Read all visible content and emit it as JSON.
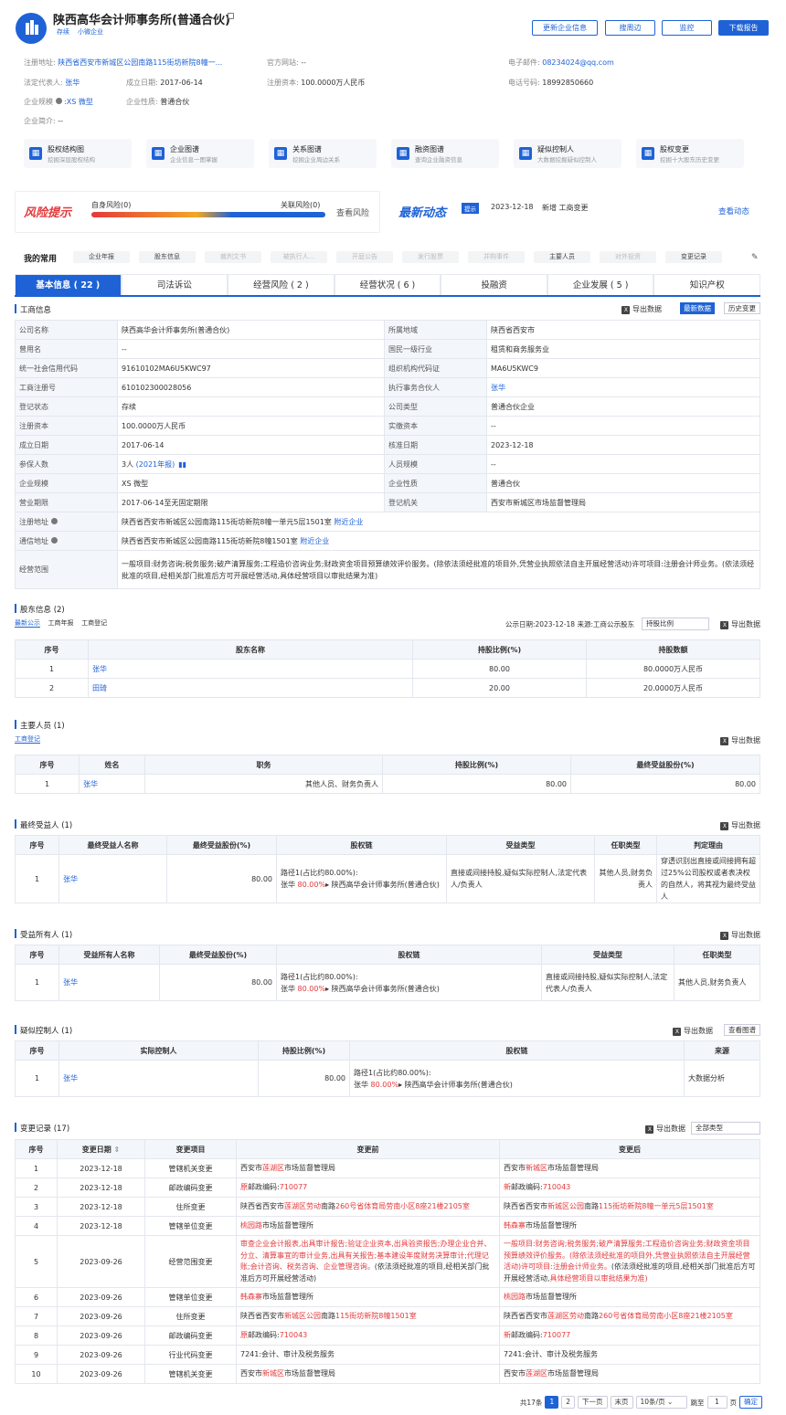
{
  "company": {
    "name": "陕西高华会计师事务所(普通合伙)",
    "status_tag": "存续",
    "size_tag": "小微企业"
  },
  "top_buttons": {
    "update": "更新企业信息",
    "nearby": "搜周边",
    "monitor": "监控",
    "download": "下载报告"
  },
  "basic": {
    "addr_label": "注册地址:",
    "addr_value": "陕西省西安市新城区公园南路115街坊新院8幢一...",
    "website_label": "官方网站:",
    "website_value": "--",
    "email_label": "电子邮件:",
    "email_value": "08234024@qq.com",
    "legal_label": "法定代表人:",
    "legal_value": "张华",
    "found_label": "成立日期:",
    "found_value": "2017-06-14",
    "capital_label": "注册资本:",
    "capital_value": "100.0000万人民币",
    "phone_label": "电话号码:",
    "phone_value": "18992850660",
    "scale_label": "企业规模",
    "scale_value": ":XS 微型",
    "nature_label": "企业性质:",
    "nature_value": "普通合伙",
    "intro_label": "企业简介:",
    "intro_value": "--"
  },
  "tools": [
    {
      "title": "股权结构图",
      "sub": "挖掘深层股权结构",
      "icon": "structure-icon"
    },
    {
      "title": "企业图谱",
      "sub": "企业信息一图掌握",
      "icon": "graph-icon"
    },
    {
      "title": "关系图谱",
      "sub": "挖掘企业周边关系",
      "icon": "relation-icon"
    },
    {
      "title": "融资图谱",
      "sub": "查询企业融资信息",
      "icon": "finance-icon"
    },
    {
      "title": "疑似控制人",
      "sub": "大数据挖掘疑似控制人",
      "icon": "person-icon"
    },
    {
      "title": "股权变更",
      "sub": "挖掘十大股东历史变更",
      "icon": "history-icon"
    }
  ],
  "risk": {
    "title": "风险提示",
    "self": "自身风险(0)",
    "related": "关联风险(0)",
    "view": "查看风险"
  },
  "news": {
    "title": "最新动态",
    "badge": "提示",
    "date": "2023-12-18",
    "text": "新增 工商变更",
    "view": "查看动态"
  },
  "common": {
    "title": "我的常用",
    "chips": [
      "企业年报",
      "股东信息",
      "裁判文书",
      "被执行人...",
      "开庭公告",
      "发行股票",
      "并购事件",
      "主要人员",
      "对外投资",
      "变更记录"
    ],
    "disabled": [
      2,
      3,
      4,
      5,
      6,
      8
    ]
  },
  "tabs": [
    "基本信息 ( 22 )",
    "司法诉讼",
    "经营风险 ( 2 )",
    "经营状况 ( 6 )",
    "投融资",
    "企业发展 ( 5 )",
    "知识产权"
  ],
  "gs": {
    "title": "工商信息",
    "export": "导出数据",
    "latest": "最新数据",
    "history": "历史变更",
    "rows": [
      [
        "公司名称",
        "陕西高华会计师事务所(普通合伙)",
        "所属地域",
        "陕西省西安市"
      ],
      [
        "曾用名",
        "--",
        "国民一级行业",
        "租赁和商务服务业"
      ],
      [
        "统一社会信用代码",
        "91610102MA6U5KWC97",
        "组织机构代码证",
        "MA6U5KWC9"
      ],
      [
        "工商注册号",
        "610102300028056",
        "执行事务合伙人",
        "张华"
      ],
      [
        "登记状态",
        "存续",
        "公司类型",
        "普通合伙企业"
      ],
      [
        "注册资本",
        "100.0000万人民币",
        "实缴资本",
        "--"
      ],
      [
        "成立日期",
        "2017-06-14",
        "核准日期",
        "2023-12-18"
      ],
      [
        "参保人数",
        "3人",
        "人员规模",
        "--"
      ],
      [
        "企业规模",
        "XS 微型",
        "企业性质",
        "普通合伙"
      ],
      [
        "营业期限",
        "2017-06-14至无固定期限",
        "登记机关",
        "西安市新城区市场监督管理局"
      ]
    ],
    "insured_year": "(2021年报)",
    "reg_addr_label": "注册地址",
    "reg_addr": "陕西省西安市新城区公园南路115街坊新院8幢一单元5层1501室",
    "nearby": "附近企业",
    "mail_addr_label": "通信地址",
    "mail_addr": "陕西省西安市新城区公园南路115街坊新院8幢1501室",
    "scope_label": "经营范围",
    "scope": "一般项目:财务咨询;税务服务;破产清算服务;工程造价咨询业务;财政资金项目预算绩效评价服务。(除依法须经批准的项目外,凭营业执照依法自主开展经营活动)许可项目:注册会计师业务。(依法须经批准的项目,经相关部门批准后方可开展经营活动,具体经营项目以审批结果为准)"
  },
  "shareholders": {
    "title": "股东信息 (2)",
    "subtabs": [
      "最新公示",
      "工商年报",
      "工商登记"
    ],
    "pubinfo": "公示日期:2023-12-18 来源:工商公示股东",
    "sort": "持股比例",
    "export": "导出数据",
    "headers": [
      "序号",
      "股东名称",
      "持股比例(%)",
      "持股数额"
    ],
    "rows": [
      [
        "1",
        "张华",
        "80.00",
        "80.0000万人民币"
      ],
      [
        "2",
        "田琦",
        "20.00",
        "20.0000万人民币"
      ]
    ]
  },
  "persons": {
    "title": "主要人员 (1)",
    "subtab": "工商登记",
    "export": "导出数据",
    "headers": [
      "序号",
      "姓名",
      "职务",
      "持股比例(%)",
      "最终受益股份(%)"
    ],
    "rows": [
      [
        "1",
        "张华",
        "其他人员、财务负责人",
        "80.00",
        "80.00"
      ]
    ]
  },
  "ubo": {
    "title": "最终受益人 (1)",
    "export": "导出数据",
    "headers": [
      "序号",
      "最终受益人名称",
      "最终受益股份(%)",
      "股权链",
      "受益类型",
      "任职类型",
      "判定理由"
    ],
    "row": {
      "no": "1",
      "name": "张华",
      "pct": "80.00",
      "path": "路径1(占比约80.00%):",
      "from": "张华",
      "chain_pct": "80.00%",
      "to": "陕西高华会计师事务所(普通合伙)",
      "type": "直接或间接持股,疑似实际控制人,法定代表人/负责人",
      "job": "其他人员,财务负责人",
      "reason": "穿透识别出直接或间接拥有超过25%公司股权或者表决权的自然人，将其视为最终受益人"
    }
  },
  "bo": {
    "title": "受益所有人 (1)",
    "export": "导出数据",
    "headers": [
      "序号",
      "受益所有人名称",
      "最终受益股份(%)",
      "股权链",
      "受益类型",
      "任职类型"
    ],
    "row": {
      "no": "1",
      "name": "张华",
      "pct": "80.00",
      "path": "路径1(占比约80.00%):",
      "from": "张华",
      "chain_pct": "80.00%",
      "to": "陕西高华会计师事务所(普通合伙)",
      "type": "直接或间接持股,疑似实际控制人,法定代表人/负责人",
      "job": "其他人员,财务负责人"
    }
  },
  "ctrl": {
    "title": "疑似控制人 (1)",
    "export": "导出数据",
    "view": "查看图谱",
    "headers": [
      "序号",
      "实际控制人",
      "持股比例(%)",
      "股权链",
      "来源"
    ],
    "row": {
      "no": "1",
      "name": "张华",
      "pct": "80.00",
      "path": "路径1(占比约80.00%):",
      "from": "张华",
      "chain_pct": "80.00%",
      "to": "陕西高华会计师事务所(普通合伙)",
      "src": "大数据分析"
    }
  },
  "changes": {
    "title": "变更记录 (17)",
    "export": "导出数据",
    "filter": "全部类型",
    "headers": [
      "序号",
      "变更日期",
      "变更项目",
      "变更前",
      "变更后"
    ],
    "rows": [
      {
        "no": "1",
        "date": "2023-12-18",
        "item": "管辖机关变更",
        "before": [
          [
            "西安市",
            0
          ],
          [
            "莲湖区",
            1
          ],
          [
            "市场监督管理局",
            0
          ]
        ],
        "after": [
          [
            "西安市",
            0
          ],
          [
            "新城区",
            1
          ],
          [
            "市场监督管理局",
            0
          ]
        ]
      },
      {
        "no": "2",
        "date": "2023-12-18",
        "item": "邮政编码变更",
        "before": [
          [
            "原",
            1
          ],
          [
            "邮政编码:",
            0
          ],
          [
            "710077",
            1
          ]
        ],
        "after": [
          [
            "新",
            1
          ],
          [
            "邮政编码:",
            0
          ],
          [
            "710043",
            1
          ]
        ]
      },
      {
        "no": "3",
        "date": "2023-12-18",
        "item": "住所变更",
        "before": [
          [
            "陕西省西安市",
            0
          ],
          [
            "莲湖区劳动",
            1
          ],
          [
            "南路",
            0
          ],
          [
            "260号省体育局劳南小区8座21楼2105室",
            1
          ]
        ],
        "after": [
          [
            "陕西省西安市",
            0
          ],
          [
            "新城区公园",
            1
          ],
          [
            "南路",
            0
          ],
          [
            "115街坊新院8幢一单元5层1501室",
            1
          ]
        ]
      },
      {
        "no": "4",
        "date": "2023-12-18",
        "item": "管辖单位变更",
        "before": [
          [
            "桃园路",
            1
          ],
          [
            "市场监督管理所",
            0
          ]
        ],
        "after": [
          [
            "韩森寨",
            1
          ],
          [
            "市场监督管理所",
            0
          ]
        ]
      },
      {
        "no": "5",
        "date": "2023-09-26",
        "item": "经营范围变更",
        "before": [
          [
            "审查企业会计报表,出具审计报告;验证企业资本,出具验资报告;办理企业合并、分立、清算事宜的审计业务,出具有关报告;基本建设年度财务决算审计;代理记账;会计咨询、税务咨询、企业管理咨询。",
            1
          ],
          [
            "(依法须经批准的项目,经相关部门批准后方可开展经营活动)",
            0
          ]
        ],
        "after": [
          [
            "一般项目:财务咨询;税务服务;破产清算服务;工程造价咨询业务;财政资金项目预算绩效评价服务。(除依法须经批准的项目外,凭营业执照依法自主开展经营活动)许可项目:注册会计师业务。",
            1
          ],
          [
            "(依法须经批准的项目,经相关部门批准后方可开展经营活动,",
            0
          ],
          [
            "具体经营项目以审批结果为准)",
            1
          ]
        ]
      },
      {
        "no": "6",
        "date": "2023-09-26",
        "item": "管辖单位变更",
        "before": [
          [
            "韩森寨",
            1
          ],
          [
            "市场监督管理所",
            0
          ]
        ],
        "after": [
          [
            "桃园路",
            1
          ],
          [
            "市场监督管理所",
            0
          ]
        ]
      },
      {
        "no": "7",
        "date": "2023-09-26",
        "item": "住所变更",
        "before": [
          [
            "陕西省西安市",
            0
          ],
          [
            "新城区公园",
            1
          ],
          [
            "南路",
            0
          ],
          [
            "115街坊新院8幢1501室",
            1
          ]
        ],
        "after": [
          [
            "陕西省西安市",
            0
          ],
          [
            "莲湖区劳动",
            1
          ],
          [
            "南路",
            0
          ],
          [
            "260号省体育局劳南小区8座21楼2105室",
            1
          ]
        ]
      },
      {
        "no": "8",
        "date": "2023-09-26",
        "item": "邮政编码变更",
        "before": [
          [
            "原",
            1
          ],
          [
            "邮政编码:",
            0
          ],
          [
            "710043",
            1
          ]
        ],
        "after": [
          [
            "新",
            1
          ],
          [
            "邮政编码:",
            0
          ],
          [
            "710077",
            1
          ]
        ]
      },
      {
        "no": "9",
        "date": "2023-09-26",
        "item": "行业代码变更",
        "before": [
          [
            "7241:会计、审计及税务服务",
            0
          ]
        ],
        "after": [
          [
            "7241:会计、审计及税务服务",
            0
          ]
        ]
      },
      {
        "no": "10",
        "date": "2023-09-26",
        "item": "管辖机关变更",
        "before": [
          [
            "西安市",
            0
          ],
          [
            "新城区",
            1
          ],
          [
            "市场监督管理局",
            0
          ]
        ],
        "after": [
          [
            "西安市",
            0
          ],
          [
            "莲湖区",
            1
          ],
          [
            "市场监督管理局",
            0
          ]
        ]
      }
    ]
  },
  "pager": {
    "total": "共17条",
    "p1": "1",
    "p2": "2",
    "next": "下一页",
    "last": "末页",
    "size": "10条/页",
    "jump": "跳至",
    "page": "1",
    "unit": "页",
    "ok": "确定"
  }
}
